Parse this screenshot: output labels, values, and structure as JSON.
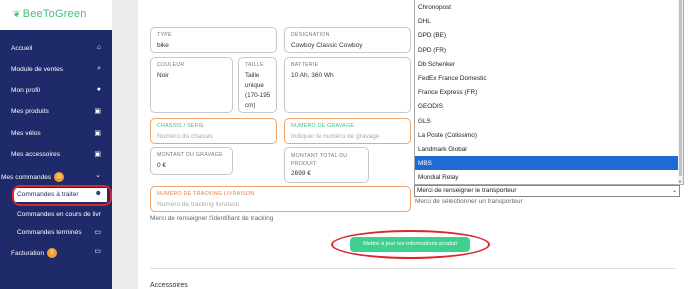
{
  "brand": {
    "logo_text": "BeeToGreen"
  },
  "sidebar": {
    "items": [
      {
        "label": "Accueil",
        "icon": "home-icon",
        "glyph": "⌂"
      },
      {
        "label": "Module de ventes",
        "icon": "search-icon",
        "glyph": "⌕"
      },
      {
        "label": "Mon profil",
        "icon": "user-icon",
        "glyph": "●"
      },
      {
        "label": "Mes produits",
        "icon": "briefcase-icon",
        "glyph": "▣"
      },
      {
        "label": "Mes vélos",
        "icon": "briefcase-icon",
        "glyph": "▣"
      },
      {
        "label": "Mes accessoires",
        "icon": "briefcase-icon",
        "glyph": "▣"
      }
    ],
    "commandes": {
      "label": "Mes commandes",
      "badge": "11",
      "icon": "chevron-down-icon",
      "glyph": "⌄"
    },
    "subitems": [
      {
        "label": "Commandes à traiter",
        "icon": "people-icon",
        "glyph": "☻",
        "active": true
      },
      {
        "label": "Commandes en cours de livr",
        "icon": "",
        "glyph": ""
      },
      {
        "label": "Commandes terminés",
        "icon": "card-icon",
        "glyph": "▭"
      }
    ],
    "facturation": {
      "label": "Facturation",
      "badge": "2",
      "icon": "card-icon",
      "glyph": "▭"
    }
  },
  "form": {
    "type": {
      "label": "TYPE",
      "value": "bike"
    },
    "designation": {
      "label": "DÉSIGNATION",
      "value": "Cowboy Classic Cowboy"
    },
    "couleur": {
      "label": "COULEUR",
      "value": "Noir"
    },
    "taille": {
      "label": "TAILLE",
      "value_lines": [
        "Taille",
        "unique",
        "(170-195",
        "cm)"
      ]
    },
    "batterie": {
      "label": "BATTERIE",
      "value": "10 Ah, 360 Wh"
    },
    "chassis": {
      "label": "CHASSIS / SÉRIE",
      "placeholder": "Numéro du chassis"
    },
    "gravage": {
      "label": "NUMÉRO DE GRAVAGE",
      "placeholder": "Indiquer le numéro de gravage"
    },
    "montant_gravage": {
      "label": "MONTANT DU GRAVAGE",
      "value": "0 €"
    },
    "montant_total": {
      "label_lines": [
        "MONTANT TOTAL DU",
        "PRODUIT"
      ],
      "value": "2699 €"
    },
    "tracking": {
      "label": "NUMÉRO DE TRACKING LIVRAISON",
      "placeholder": "Numéro de tracking livraison"
    },
    "tracking_helper": "Merci de renseigner l'identifiant de tracking",
    "transporteur_select": "Merci de renseigner le transporteur",
    "transporteur_helper": "Merci de sélectionner un transporteur",
    "submit_label": "Mettre à jour les informations produit",
    "next_section_peek": "Accessoires"
  },
  "carrier_options": [
    {
      "label": "Chronopost",
      "selected": false
    },
    {
      "label": "DHL",
      "selected": false
    },
    {
      "label": "DPD (BE)",
      "selected": false
    },
    {
      "label": "DPD (FR)",
      "selected": false
    },
    {
      "label": "Db Schenker",
      "selected": false
    },
    {
      "label": "FedEx France Domestic",
      "selected": false
    },
    {
      "label": "France Express (FR)",
      "selected": false
    },
    {
      "label": "GEODIS",
      "selected": false
    },
    {
      "label": "GLS",
      "selected": false
    },
    {
      "label": "La Poste (Colissimo)",
      "selected": false
    },
    {
      "label": "Landmark Global",
      "selected": false
    },
    {
      "label": "MBS",
      "selected": true
    },
    {
      "label": "Mondial Relay",
      "selected": false
    }
  ],
  "colors": {
    "sidebar": "#1f2a6b",
    "accent_green": "#3fcf8e",
    "badge": "#f0a22e",
    "annotation_red": "#d8272d",
    "selected_option": "#1e6bd6"
  }
}
